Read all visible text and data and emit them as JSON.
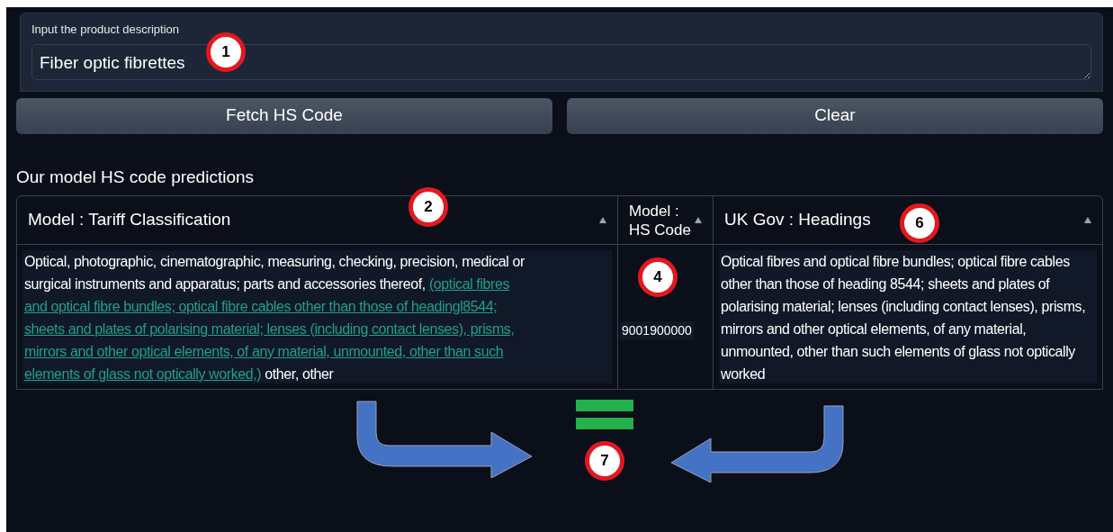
{
  "input": {
    "label": "Input the product description",
    "value": "Fiber optic fibrettes"
  },
  "buttons": [
    {
      "label": "Fetch HS Code"
    },
    {
      "label": "Clear"
    }
  ],
  "section_title": "Our model HS code predictions",
  "table": {
    "columns": [
      {
        "label": "Model : Tariff Classification"
      },
      {
        "label": "Model : HS Code"
      },
      {
        "label": "UK Gov : Headings"
      }
    ],
    "rows": [
      [
        {
          "lines": [
            [
              {
                "kind": "plain",
                "text": "Optical, photographic, cinematographic, measuring, checking, precision, medical or"
              }
            ],
            [
              {
                "kind": "plain",
                "text": "surgical instruments and apparatus; parts and accessories thereof, "
              },
              {
                "kind": "link",
                "text": "(optical fibres"
              }
            ],
            [
              {
                "kind": "link",
                "text": "and optical fibre bundles; optical fibre cables other than those of headingl8544;"
              }
            ],
            [
              {
                "kind": "link",
                "text": "sheets and plates of polarising material; lenses (including contact lenses), prisms,"
              }
            ],
            [
              {
                "kind": "link",
                "text": "mirrors and other optical elements, of any material, unmounted, other than such"
              }
            ],
            [
              {
                "kind": "link",
                "text": "elements of glass not optically worked,)"
              },
              {
                "kind": "plain",
                "text": " other, other"
              }
            ]
          ]
        },
        {
          "parts": [
            {
              "kind": "plain",
              "text": "9001900000"
            }
          ]
        },
        {
          "parts": [
            {
              "kind": "plain",
              "text": "Optical fibres and optical fibre bundles; optical fibre cables other than those of heading 8544; sheets and plates of polarising material; lenses (including contact lenses), prisms, mirrors and other optical elements, of any material, unmounted, other than such elements of glass not optically worked"
            }
          ]
        }
      ]
    ]
  },
  "annotations": [
    {
      "label": "1"
    },
    {
      "label": "2"
    },
    {
      "label": "4"
    },
    {
      "label": "6"
    },
    {
      "label": "7"
    }
  ]
}
